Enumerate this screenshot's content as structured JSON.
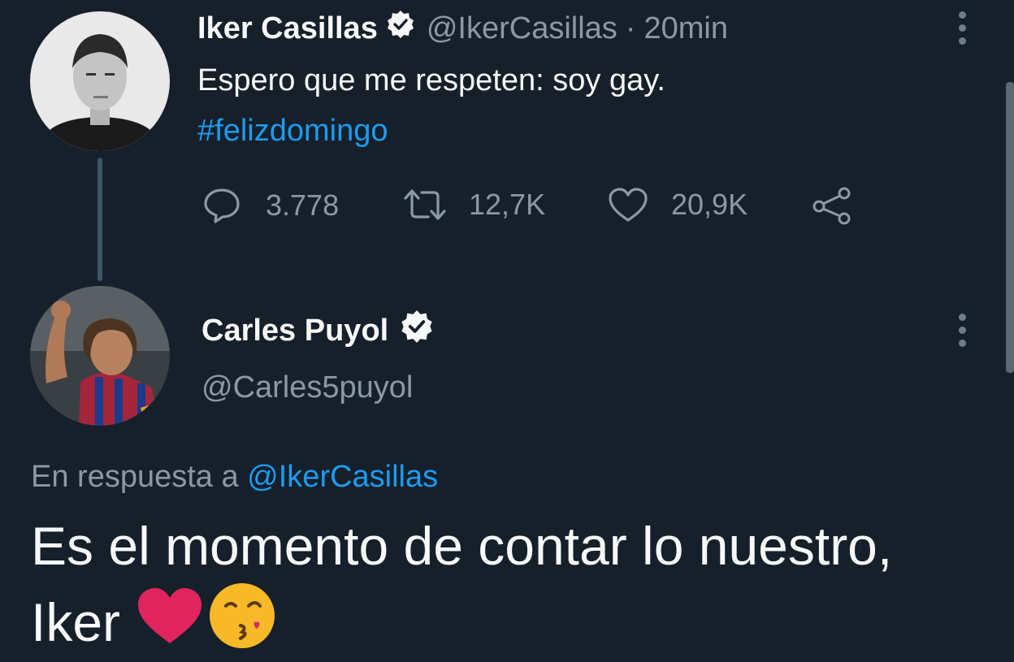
{
  "tweet": {
    "author_name": "Iker Casillas",
    "handle": "@IkerCasillas",
    "separator": "·",
    "time": "20min",
    "text": "Espero que me respeten: soy gay.",
    "hashtag": "#felizdomingo",
    "stats": {
      "replies": "3.778",
      "retweets": "12,7K",
      "likes": "20,9K"
    }
  },
  "reply": {
    "author_name": "Carles Puyol",
    "handle": "@Carles5puyol",
    "reply_to_prefix": "En respuesta a",
    "reply_to_handle": "@IkerCasillas",
    "text_line1": "Es el momento de contar lo nuestro,",
    "text_line2": "Iker",
    "emojis": [
      "❤️",
      "😘"
    ]
  },
  "icons": [
    "verified-badge-icon",
    "more-options-icon",
    "reply-icon",
    "retweet-icon",
    "like-icon",
    "share-icon"
  ],
  "colors": {
    "background": "#15202b",
    "text": "#f7f9f9",
    "muted": "#8b98a5",
    "link": "#1d9bf0",
    "heart": "#e0245e"
  }
}
